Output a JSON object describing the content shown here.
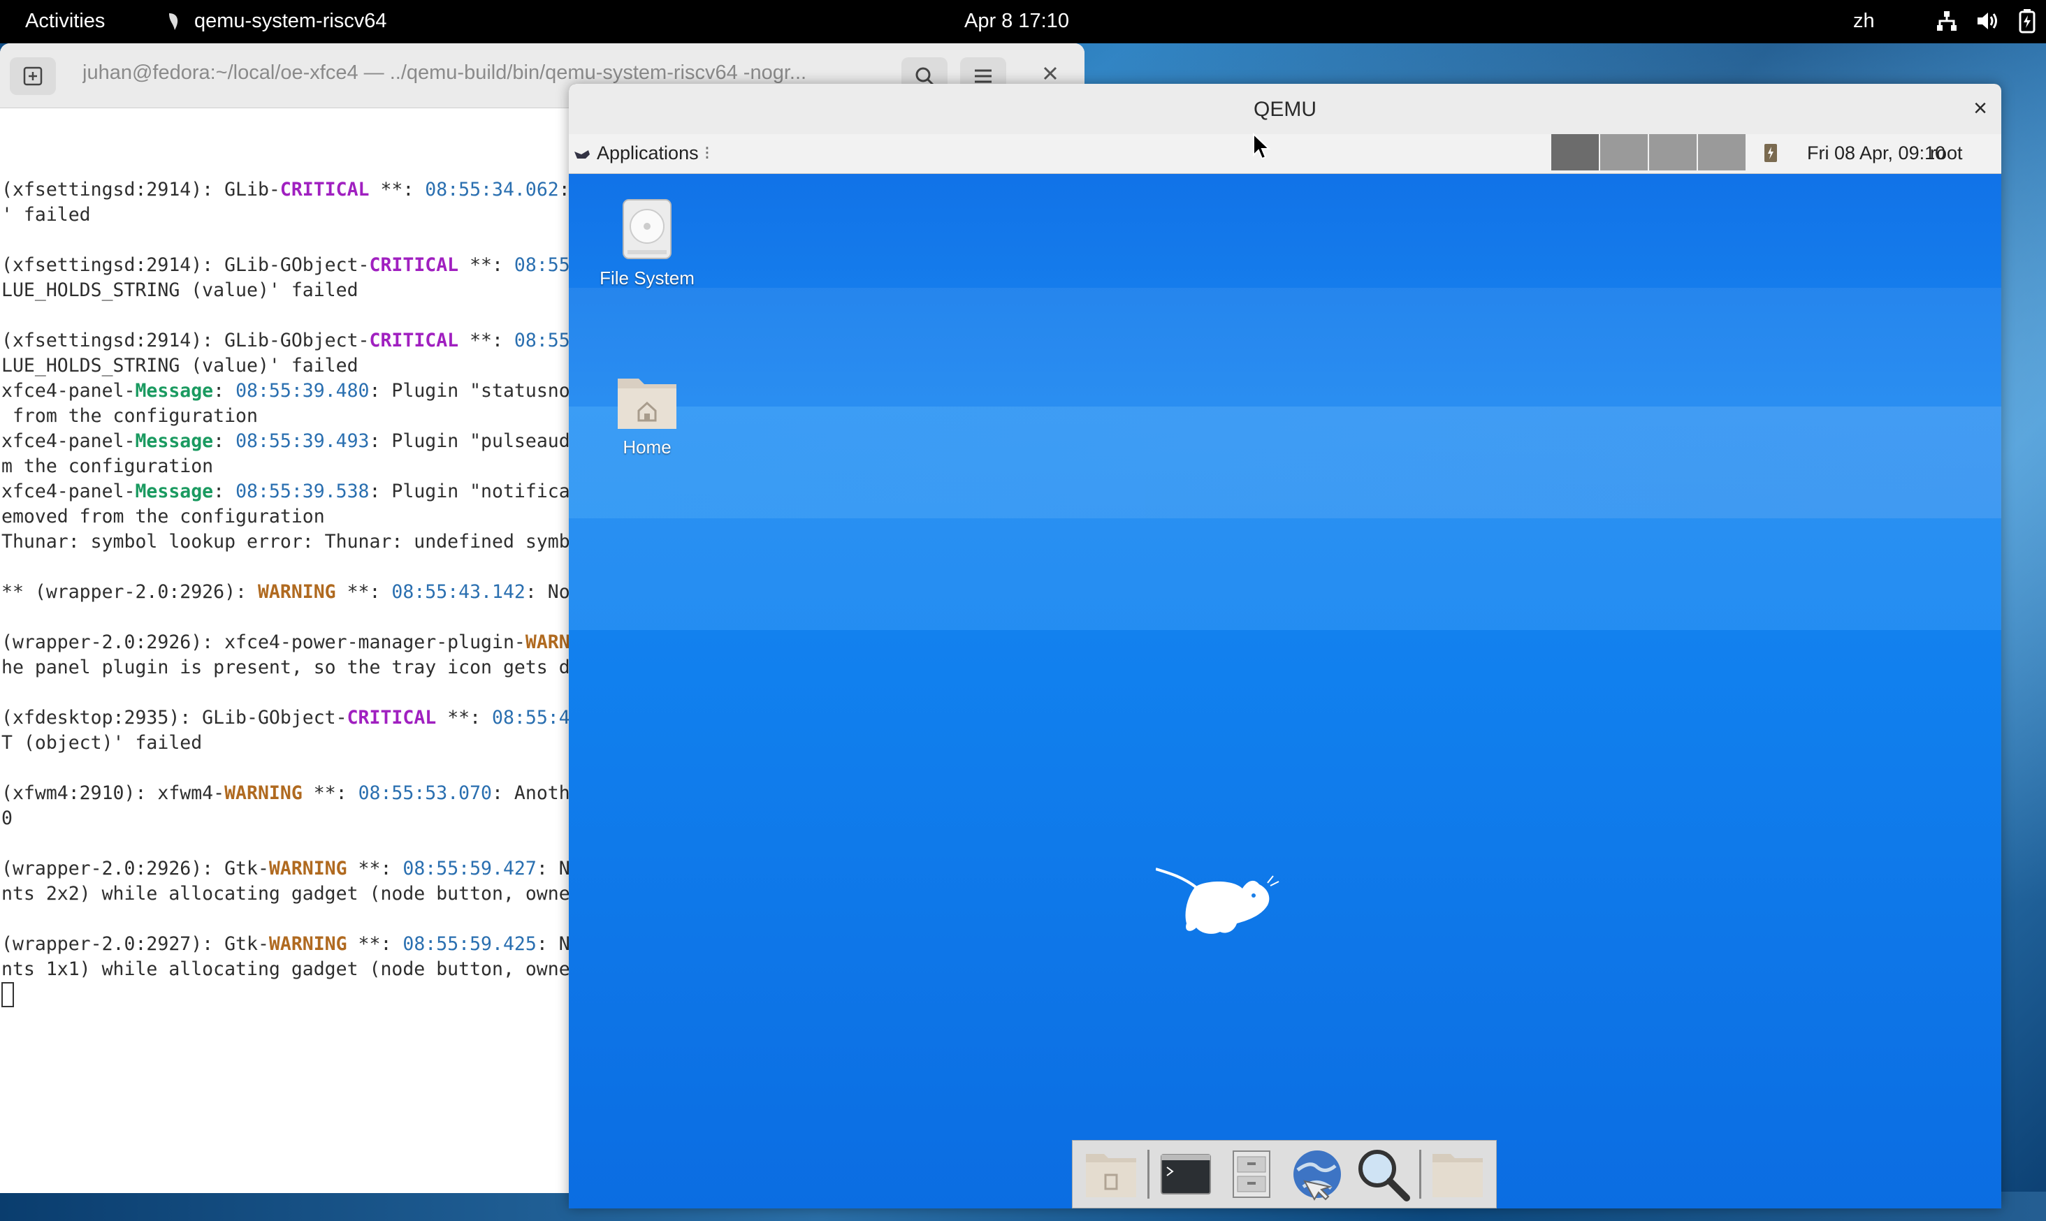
{
  "topbar": {
    "activities": "Activities",
    "app_name": "qemu-system-riscv64",
    "clock": "Apr 8  17:10",
    "lang": "zh",
    "icons": [
      "network-icon",
      "volume-icon",
      "battery-icon"
    ]
  },
  "terminal": {
    "title": "juhan@fedora:~/local/oe-xfce4 — ../qemu-build/bin/qemu-system-riscv64 -nogr...",
    "lines": [
      [
        {
          "t": "(xfsettingsd:2914): GLib-"
        },
        {
          "t": "CRITICAL",
          "c": "crit"
        },
        {
          "t": " **: "
        },
        {
          "t": "08:55:34.062",
          "c": "ts"
        },
        {
          "t": ":"
        }
      ],
      [
        {
          "t": "' failed"
        }
      ],
      [
        {
          "t": ""
        }
      ],
      [
        {
          "t": "(xfsettingsd:2914): GLib-GObject-"
        },
        {
          "t": "CRITICAL",
          "c": "crit"
        },
        {
          "t": " **: "
        },
        {
          "t": "08:55",
          "c": "ts"
        }
      ],
      [
        {
          "t": "LUE_HOLDS_STRING (value)' failed"
        }
      ],
      [
        {
          "t": ""
        }
      ],
      [
        {
          "t": "(xfsettingsd:2914): GLib-GObject-"
        },
        {
          "t": "CRITICAL",
          "c": "crit"
        },
        {
          "t": " **: "
        },
        {
          "t": "08:55",
          "c": "ts"
        }
      ],
      [
        {
          "t": "LUE_HOLDS_STRING (value)' failed"
        }
      ],
      [
        {
          "t": "xfce4-panel-"
        },
        {
          "t": "Message",
          "c": "msg"
        },
        {
          "t": ": "
        },
        {
          "t": "08:55:39.480",
          "c": "ts"
        },
        {
          "t": ": Plugin \"statusno"
        }
      ],
      [
        {
          "t": " from the configuration"
        }
      ],
      [
        {
          "t": "xfce4-panel-"
        },
        {
          "t": "Message",
          "c": "msg"
        },
        {
          "t": ": "
        },
        {
          "t": "08:55:39.493",
          "c": "ts"
        },
        {
          "t": ": Plugin \"pulseaud"
        }
      ],
      [
        {
          "t": "m the configuration"
        }
      ],
      [
        {
          "t": "xfce4-panel-"
        },
        {
          "t": "Message",
          "c": "msg"
        },
        {
          "t": ": "
        },
        {
          "t": "08:55:39.538",
          "c": "ts"
        },
        {
          "t": ": Plugin \"notifica"
        }
      ],
      [
        {
          "t": "emoved from the configuration"
        }
      ],
      [
        {
          "t": "Thunar: symbol lookup error: Thunar: undefined symb"
        }
      ],
      [
        {
          "t": ""
        }
      ],
      [
        {
          "t": "** (wrapper-2.0:2926): "
        },
        {
          "t": "WARNING",
          "c": "warn"
        },
        {
          "t": " **: "
        },
        {
          "t": "08:55:43.142",
          "c": "ts"
        },
        {
          "t": ": No"
        }
      ],
      [
        {
          "t": ""
        }
      ],
      [
        {
          "t": "(wrapper-2.0:2926): xfce4-power-manager-plugin-"
        },
        {
          "t": "WARN",
          "c": "warn"
        }
      ],
      [
        {
          "t": "he panel plugin is present, so the tray icon gets d"
        }
      ],
      [
        {
          "t": ""
        }
      ],
      [
        {
          "t": "(xfdesktop:2935): GLib-GObject-"
        },
        {
          "t": "CRITICAL",
          "c": "crit"
        },
        {
          "t": " **: "
        },
        {
          "t": "08:55:4",
          "c": "ts"
        }
      ],
      [
        {
          "t": "T (object)' failed"
        }
      ],
      [
        {
          "t": ""
        }
      ],
      [
        {
          "t": "(xfwm4:2910): xfwm4-"
        },
        {
          "t": "WARNING",
          "c": "warn"
        },
        {
          "t": " **: "
        },
        {
          "t": "08:55:53.070",
          "c": "ts"
        },
        {
          "t": ": Anoth"
        }
      ],
      [
        {
          "t": "0"
        }
      ],
      [
        {
          "t": ""
        }
      ],
      [
        {
          "t": "(wrapper-2.0:2926): Gtk-"
        },
        {
          "t": "WARNING",
          "c": "warn"
        },
        {
          "t": " **: "
        },
        {
          "t": "08:55:59.427",
          "c": "ts"
        },
        {
          "t": ": N"
        }
      ],
      [
        {
          "t": "nts 2x2) while allocating gadget (node button, owne"
        }
      ],
      [
        {
          "t": ""
        }
      ],
      [
        {
          "t": "(wrapper-2.0:2927): Gtk-"
        },
        {
          "t": "WARNING",
          "c": "warn"
        },
        {
          "t": " **: "
        },
        {
          "t": "08:55:59.425",
          "c": "ts"
        },
        {
          "t": ": N"
        }
      ],
      [
        {
          "t": "nts 1x1) while allocating gadget (node button, owne"
        }
      ]
    ]
  },
  "qemu": {
    "title": "QEMU",
    "close": "×",
    "panel": {
      "applications": "Applications",
      "date": "Fri 08 Apr, 09:10",
      "user": "root"
    },
    "desktop_icons": [
      {
        "label": "File System",
        "icon": "drive-icon"
      },
      {
        "label": "Home",
        "icon": "home-folder-icon"
      }
    ],
    "dock_icons": [
      "show-desktop-icon",
      "terminal-icon",
      "file-manager-icon",
      "web-browser-icon",
      "search-icon",
      "folder-icon"
    ]
  }
}
